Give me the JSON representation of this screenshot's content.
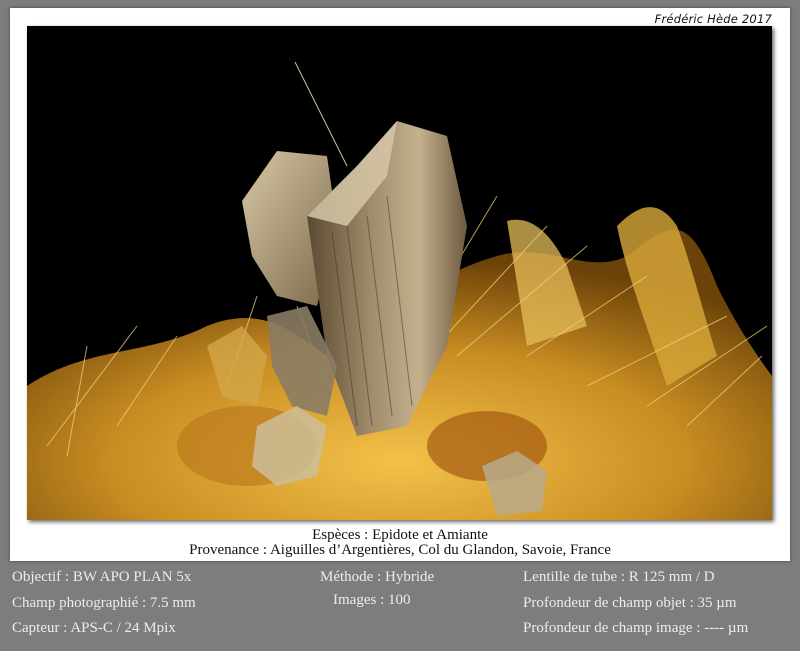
{
  "credit": "Frédéric Hède 2017",
  "photo": {
    "subject": "epidote-crystal-with-asbestos-fibers",
    "colors": {
      "background": "#000000",
      "fibers": "#d9a93a",
      "crystal": "#9a8a6a"
    }
  },
  "caption": {
    "species": "Espèces : Epidote et Amiante",
    "origin": "Provenance : Aiguilles d’Argentières, Col du Glandon, Savoie, France"
  },
  "info": {
    "objective": "Objectif : BW APO PLAN 5x",
    "field": "Champ photographié : 7.5 mm",
    "sensor": "Capteur : APS-C / 24 Mpix",
    "method": "Méthode : Hybride",
    "images": "Images : 100",
    "tube_lens": "Lentille de tube : R 125 mm / D",
    "dof_object": "Profondeur de champ objet : 35 µm",
    "dof_image": "Profondeur de champ image : ---- µm"
  }
}
